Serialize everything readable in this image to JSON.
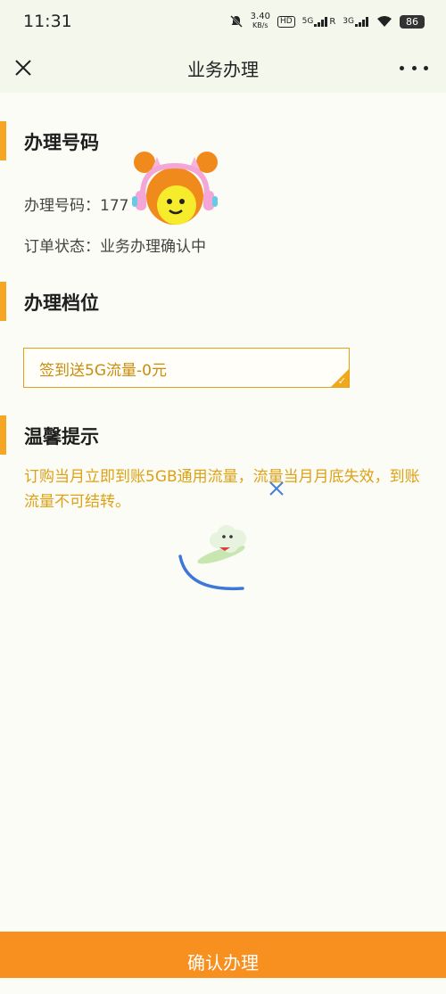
{
  "status_bar": {
    "time": "11:31",
    "speed_value": "3.40",
    "speed_unit": "KB/s",
    "hd_label": "HD",
    "sim1_label": "5G",
    "sim2_label": "3G",
    "roaming": "R",
    "battery": "86"
  },
  "header": {
    "title": "业务办理"
  },
  "number_section": {
    "title": "办理号码",
    "number_label": "办理号码：",
    "number_value": "177",
    "order_status_label": "订单状态：",
    "order_status_value": "业务办理确认中"
  },
  "tier_section": {
    "title": "办理档位",
    "selected_option": "签到送5G流量-0元"
  },
  "tips_section": {
    "title": "温馨提示",
    "text": "订购当月立即到账5GB通用流量，流量当月月底失效，到账流量不可结转。"
  },
  "footer": {
    "confirm_label": "确认办理"
  },
  "colors": {
    "accent": "#f7901e",
    "section_bar": "#f6a623",
    "tip_text": "#dda116",
    "header_bg": "#f3f7ec",
    "page_bg": "#fbfcf5"
  },
  "icons": [
    "close-icon",
    "more-icon",
    "mute-icon",
    "wifi-icon",
    "battery-icon",
    "check-icon"
  ]
}
